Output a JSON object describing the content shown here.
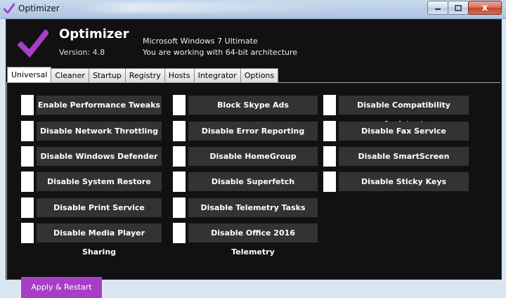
{
  "window": {
    "title": "Optimizer",
    "close_glyph": "x"
  },
  "header": {
    "app_name": "Optimizer",
    "version": "Version: 4.8",
    "os": "Microsoft Windows 7 Ultimate",
    "arch": "You are working with 64-bit architecture"
  },
  "colors": {
    "accent": "#a83ec6",
    "panel_bg": "#111111",
    "item_bg": "#333333"
  },
  "tabs": [
    {
      "label": "Universal",
      "active": true
    },
    {
      "label": "Cleaner"
    },
    {
      "label": "Startup"
    },
    {
      "label": "Registry"
    },
    {
      "label": "Hosts"
    },
    {
      "label": "Integrator"
    },
    {
      "label": "Options"
    }
  ],
  "columns": [
    [
      "Enable Performance Tweaks",
      "Disable Network Throttling",
      "Disable Windows Defender",
      "Disable System Restore",
      "Disable Print Service",
      "Disable Media Player Sharing"
    ],
    [
      "Block Skype Ads",
      "Disable Error Reporting",
      "Disable HomeGroup",
      "Disable Superfetch",
      "Disable Telemetry Tasks",
      "Disable Office 2016 Telemetry"
    ],
    [
      "Disable Compatibility Assistant",
      "Disable Fax Service",
      "Disable SmartScreen",
      "Disable Sticky Keys"
    ]
  ],
  "apply_button": "Apply & Restart"
}
